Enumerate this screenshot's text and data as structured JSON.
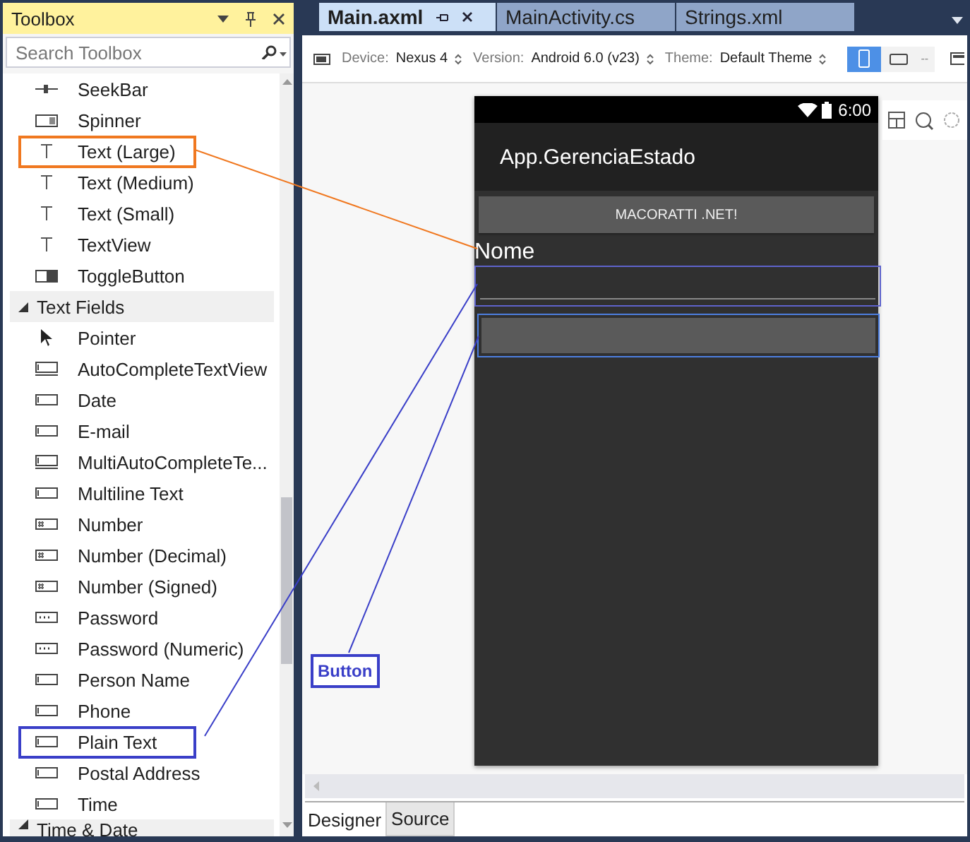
{
  "toolbox": {
    "title": "Toolbox",
    "search": {
      "placeholder": "Search Toolbox"
    },
    "items": [
      {
        "kind": "seekbar",
        "label": "SeekBar"
      },
      {
        "kind": "spinner",
        "label": "Spinner"
      },
      {
        "kind": "text",
        "label": "Text (Large)",
        "color": "#f07820"
      },
      {
        "kind": "text",
        "label": "Text (Medium)"
      },
      {
        "kind": "text",
        "label": "Text (Small)"
      },
      {
        "kind": "text",
        "label": "TextView"
      },
      {
        "kind": "toggle",
        "label": "ToggleButton"
      },
      {
        "kind": "category",
        "label": "Text Fields",
        "expanded": true
      },
      {
        "kind": "pointer",
        "label": "Pointer"
      },
      {
        "kind": "multifield",
        "label": "AutoCompleteTextView"
      },
      {
        "kind": "field",
        "label": "Date"
      },
      {
        "kind": "field",
        "label": "E-mail"
      },
      {
        "kind": "multifield",
        "label": "MultiAutoCompleteTe..."
      },
      {
        "kind": "field",
        "label": "Multiline Text"
      },
      {
        "kind": "numfield",
        "label": "Number"
      },
      {
        "kind": "numfield",
        "label": "Number (Decimal)"
      },
      {
        "kind": "numfield",
        "label": "Number (Signed)"
      },
      {
        "kind": "password",
        "label": "Password"
      },
      {
        "kind": "password",
        "label": "Password (Numeric)"
      },
      {
        "kind": "field",
        "label": "Person Name"
      },
      {
        "kind": "field",
        "label": "Phone"
      },
      {
        "kind": "field",
        "label": "Plain Text",
        "color": "#3a3fc8"
      },
      {
        "kind": "field",
        "label": "Postal Address"
      },
      {
        "kind": "field",
        "label": "Time"
      },
      {
        "kind": "category",
        "label": "Time & Date",
        "expanded": true
      }
    ]
  },
  "tabs": [
    {
      "label": "Main.axml",
      "selected": true
    },
    {
      "label": "MainActivity.cs",
      "selected": false
    },
    {
      "label": "Strings.xml",
      "selected": false
    }
  ],
  "toolbar": {
    "fields": [
      {
        "label": "Device:",
        "value": "Nexus 4"
      },
      {
        "label": "Version:",
        "value": "Android 6.0 (v23)"
      },
      {
        "label": "Theme:",
        "value": "Default Theme"
      }
    ],
    "orientations": [
      {
        "kind": "portrait",
        "selected": true
      },
      {
        "kind": "landscape",
        "selected": false
      }
    ],
    "more": "--"
  },
  "phone": {
    "time": "6:00",
    "app_title": "App.GerenciaEstado",
    "button": "MACORATTI .NET!",
    "label": "Nome"
  },
  "annotation": {
    "label": "Button",
    "color": "#3a3fc8"
  },
  "bottom_tabs": [
    {
      "label": "Designer",
      "selected": true
    },
    {
      "label": "Source",
      "selected": false
    }
  ]
}
